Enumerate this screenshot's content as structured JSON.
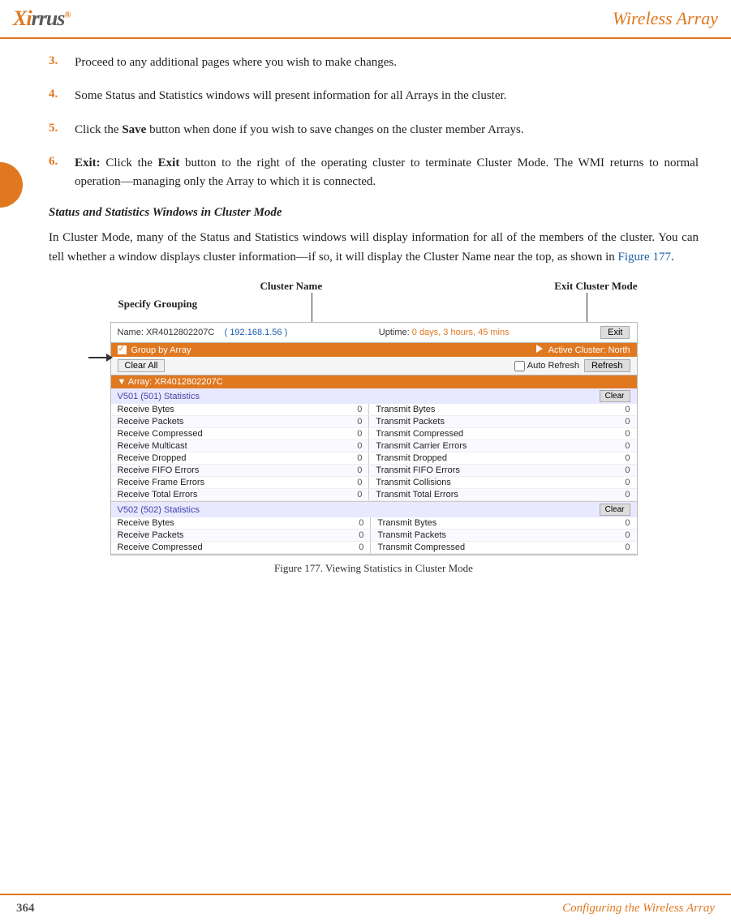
{
  "header": {
    "logo": "XIRRUS",
    "logo_reg": "®",
    "title": "Wireless Array"
  },
  "list_items": [
    {
      "num": "3.",
      "text": "Proceed to any additional pages where you wish to make changes."
    },
    {
      "num": "4.",
      "text": "Some Status and Statistics windows will present information for all Arrays in the cluster."
    },
    {
      "num": "5.",
      "text": "Click the Save button when done if you wish to save changes on the cluster member Arrays.",
      "bold_word": "Save"
    },
    {
      "num": "6.",
      "text_prefix": "Exit:",
      "text_suffix": " Click the Exit button to the right of the operating cluster to terminate Cluster Mode. The WMI returns to normal operation—managing only the Array to which it is connected."
    }
  ],
  "section_title": "Status and Statistics Windows in Cluster Mode",
  "section_body": "In Cluster Mode, many of the Status and Statistics windows will display information for all of the members of the cluster. You can tell whether a window displays cluster information—if so, it will display the Cluster Name near the top, as shown in Figure 177.",
  "section_link": "Figure 177",
  "annotations": {
    "specify_grouping": "Specify Grouping",
    "cluster_name": "Cluster Name",
    "exit_cluster": "Exit Cluster Mode"
  },
  "wmi": {
    "name_label": "Name: XR4012802207C",
    "ip": "( 192.168.1.56 )",
    "uptime_label": "Uptime:",
    "uptime_value": "0 days, 3 hours, 45 mins",
    "exit_btn": "Exit",
    "group_by_array": "Group by Array",
    "active_cluster": "Active Cluster: North",
    "clear_all_btn": "Clear All",
    "auto_refresh_label": "Auto Refresh",
    "refresh_btn": "Refresh",
    "array_header": "▼  Array: XR4012802207C",
    "stats_sections": [
      {
        "title": "V501 (501) Statistics",
        "clear_btn": "Clear",
        "rows": [
          [
            "Receive Bytes",
            "0",
            "Transmit Bytes",
            "0"
          ],
          [
            "Receive Packets",
            "0",
            "Transmit Packets",
            "0"
          ],
          [
            "Receive Compressed",
            "0",
            "Transmit Compressed",
            "0"
          ],
          [
            "Receive Multicast",
            "0",
            "Transmit Carrier Errors",
            "0"
          ],
          [
            "Receive Dropped",
            "0",
            "Transmit Dropped",
            "0"
          ],
          [
            "Receive FIFO Errors",
            "0",
            "Transmit FIFO Errors",
            "0"
          ],
          [
            "Receive Frame Errors",
            "0",
            "Transmit Collisions",
            "0"
          ],
          [
            "Receive Total Errors",
            "0",
            "Transmit Total Errors",
            "0"
          ]
        ]
      },
      {
        "title": "V502 (502) Statistics",
        "clear_btn": "Clear",
        "rows": [
          [
            "Receive Bytes",
            "0",
            "Transmit Bytes",
            "0"
          ],
          [
            "Receive Packets",
            "0",
            "Transmit Packets",
            "0"
          ],
          [
            "Receive Compressed",
            "0",
            "Transmit Compressed",
            "0"
          ]
        ]
      }
    ]
  },
  "figure_caption": "Figure 177. Viewing Statistics in Cluster Mode",
  "footer": {
    "left": "364",
    "right": "Configuring the Wireless Array"
  }
}
